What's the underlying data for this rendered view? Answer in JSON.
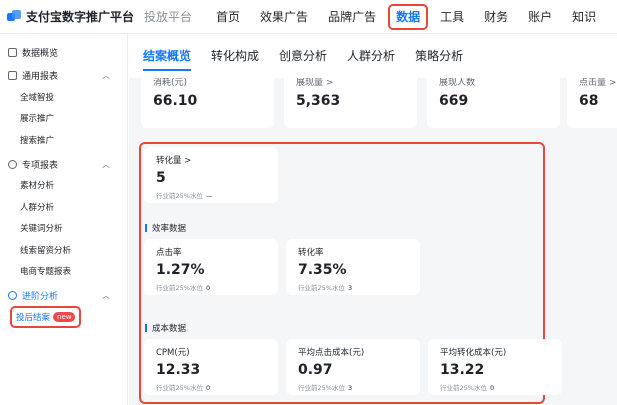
{
  "header": {
    "brand": "支付宝数字推广平台",
    "platform": "投放平台",
    "nav": [
      "首页",
      "效果广告",
      "品牌广告",
      "数据",
      "工具",
      "财务",
      "账户",
      "知识"
    ]
  },
  "sidebar": {
    "top_item": "数据概览",
    "groups": [
      {
        "label": "通用报表",
        "items": [
          "全域智投",
          "展示推广",
          "搜索推广"
        ]
      },
      {
        "label": "专项报表",
        "items": [
          "素材分析",
          "人群分析",
          "关键词分析",
          "线索留资分析",
          "电商专题报表"
        ]
      },
      {
        "label": "进阶分析",
        "items": [
          "投后结案"
        ],
        "badge": "new"
      }
    ]
  },
  "subtabs": [
    "结案概览",
    "转化构成",
    "创意分析",
    "人群分析",
    "策略分析"
  ],
  "top_metrics": [
    {
      "label": "消耗(元)",
      "value": "66.10"
    },
    {
      "label": "展现量 >",
      "value": "5,363"
    },
    {
      "label": "展现人数",
      "value": "669"
    },
    {
      "label": "点击量 >",
      "value": "68"
    }
  ],
  "conversion": {
    "label": "转化量 >",
    "value": "5",
    "bench_label": "行业前25%水位",
    "bench_value": "—"
  },
  "efficiency": {
    "title": "效率数据",
    "cards": [
      {
        "label": "点击率",
        "value": "1.27%",
        "bench_label": "行业前25%水位",
        "bench_value": "0"
      },
      {
        "label": "转化率",
        "value": "7.35%",
        "bench_label": "行业前25%水位",
        "bench_value": "3"
      }
    ]
  },
  "cost": {
    "title": "成本数据",
    "cards": [
      {
        "label": "CPM(元)",
        "value": "12.33",
        "bench_label": "行业前25%水位",
        "bench_value": "0"
      },
      {
        "label": "平均点击成本(元)",
        "value": "0.97",
        "bench_label": "行业前25%水位",
        "bench_value": "3"
      },
      {
        "label": "平均转化成本(元)",
        "value": "13.22",
        "bench_label": "行业前25%水位",
        "bench_value": "0"
      }
    ]
  }
}
